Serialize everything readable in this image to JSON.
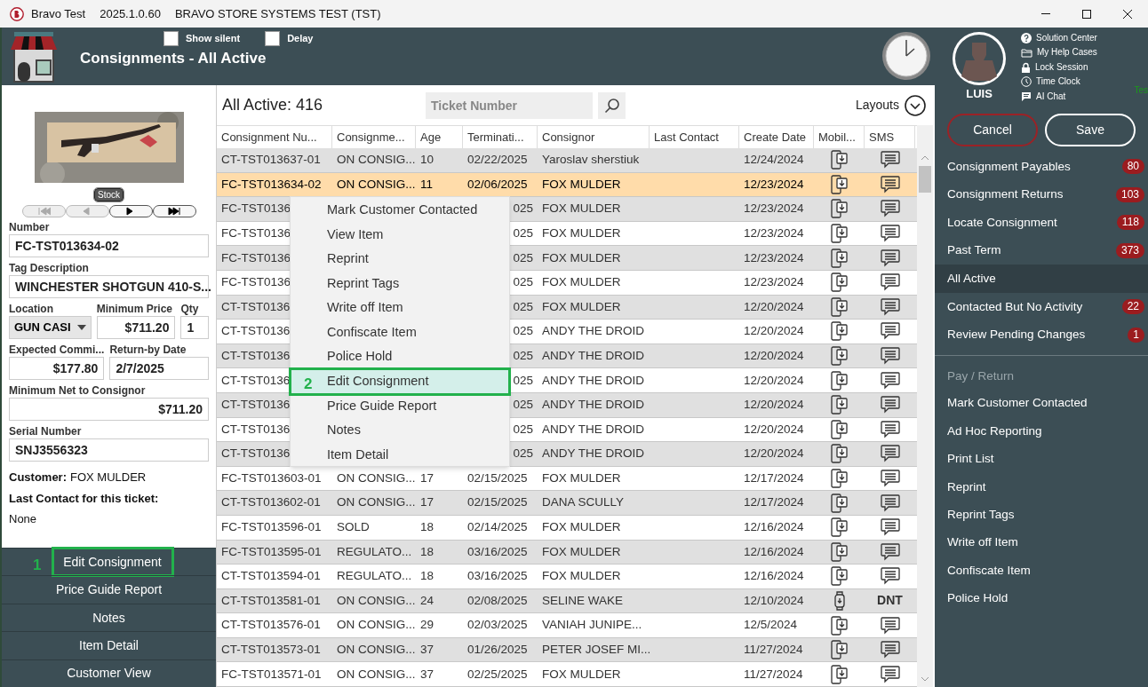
{
  "window": {
    "app": "Bravo Test",
    "version": "2025.1.0.60",
    "subtitle": "BRAVO STORE SYSTEMS TEST (TST)"
  },
  "header": {
    "title": "Consignments - All Active",
    "options": [
      {
        "label": "Show silent",
        "checked": false
      },
      {
        "label": "Delay",
        "checked": false
      }
    ]
  },
  "user": {
    "name": "LUIS",
    "links": [
      {
        "kind": "help",
        "label": "Solution Center"
      },
      {
        "kind": "folder",
        "label": "My Help Cases"
      },
      {
        "kind": "lock",
        "label": "Lock Session"
      },
      {
        "kind": "clock",
        "label": "Time Clock"
      },
      {
        "kind": "chat",
        "label": "AI Chat"
      }
    ],
    "env": "Tes"
  },
  "actions": {
    "cancel": "Cancel",
    "save": "Save"
  },
  "views": [
    {
      "label": "Consignment Payables",
      "count": "80",
      "selected": false
    },
    {
      "label": "Consignment Returns",
      "count": "103",
      "selected": false
    },
    {
      "label": "Locate Consignment",
      "count": "118",
      "selected": false
    },
    {
      "label": "Past Term",
      "count": "373",
      "selected": false
    },
    {
      "label": "All Active",
      "selected": true
    },
    {
      "label": "Contacted But No Activity",
      "count": "22",
      "selected": false
    },
    {
      "label": "Review Pending Changes",
      "count": "1",
      "selected": false
    }
  ],
  "pay_return": {
    "heading": "Pay / Return",
    "items": [
      "Mark Customer Contacted",
      "Ad Hoc Reporting",
      "Print List",
      "Reprint",
      "Reprint Tags",
      "Write off Item",
      "Confiscate Item",
      "Police Hold"
    ]
  },
  "detail": {
    "stock": "Stock",
    "nav": [
      {
        "kind": "first",
        "disabled": true
      },
      {
        "kind": "prev",
        "disabled": true
      },
      {
        "kind": "next",
        "disabled": false
      },
      {
        "kind": "last",
        "disabled": false
      }
    ],
    "number_label": "Number",
    "number": "FC-TST013634-02",
    "desc_label": "Tag Description",
    "desc": "WINCHESTER SHOTGUN 410-S...",
    "location_label": "Location",
    "location": "GUN CASI",
    "min_price_label": "Minimum Price",
    "min_price": "$711.20",
    "qty_label": "Qty",
    "qty": "1",
    "commission_label": "Expected Commi...",
    "commission": "$177.80",
    "return_label": "Return-by Date",
    "return_date": "2/7/2025",
    "net_label": "Minimum Net to Consignor",
    "net": "$711.20",
    "serial_label": "Serial Number",
    "serial": "SNJ3556323",
    "customer_label": "Customer:",
    "customer": "FOX MULDER",
    "last_contact_label": "Last Contact for this ticket:",
    "last_contact": "None",
    "buttons": [
      "Edit Consignment",
      "Price Guide Report",
      "Notes",
      "Item Detail",
      "Customer View"
    ]
  },
  "list": {
    "title": "All Active: 416",
    "search_placeholder": "Ticket Number",
    "layouts": "Layouts"
  },
  "table": {
    "columns": [
      "Consignment Nu...",
      "Consignme...",
      "Age",
      "Terminati...",
      "Consignor",
      "Last Contact",
      "Create Date",
      "Mobil...",
      "SMS"
    ],
    "rows": [
      {
        "kind": "full",
        "selected": false,
        "cells": [
          "CT-TST013637-01",
          "ON CONSIG...",
          "10",
          "02/22/2025",
          "Yaroslav sherstiuk",
          "",
          "12/24/2024"
        ],
        "watch": false
      },
      {
        "kind": "full",
        "selected": true,
        "cells": [
          "FC-TST013634-02",
          "ON CONSIG...",
          "11",
          "02/06/2025",
          "FOX MULDER",
          "",
          "12/23/2024"
        ],
        "watch": false
      },
      {
        "kind": "covered",
        "selected": false,
        "cells": [
          "FC-TST0136",
          "",
          "",
          "025",
          "FOX MULDER",
          "",
          "12/23/2024"
        ],
        "watch": false
      },
      {
        "kind": "covered",
        "selected": false,
        "cells": [
          "FC-TST0136",
          "",
          "",
          "025",
          "FOX MULDER",
          "",
          "12/23/2024"
        ],
        "watch": false
      },
      {
        "kind": "covered",
        "selected": false,
        "cells": [
          "FC-TST0136",
          "",
          "",
          "025",
          "FOX MULDER",
          "",
          "12/23/2024"
        ],
        "watch": false
      },
      {
        "kind": "covered",
        "selected": false,
        "cells": [
          "FC-TST0136",
          "",
          "",
          "025",
          "FOX MULDER",
          "",
          "12/23/2024"
        ],
        "watch": false
      },
      {
        "kind": "covered",
        "selected": false,
        "cells": [
          "CT-TST0136",
          "",
          "",
          "025",
          "FOX MULDER",
          "",
          "12/20/2024"
        ],
        "watch": false
      },
      {
        "kind": "covered",
        "selected": false,
        "cells": [
          "CT-TST0136",
          "",
          "",
          "025",
          "ANDY THE DROID",
          "",
          "12/20/2024"
        ],
        "watch": false
      },
      {
        "kind": "covered",
        "selected": false,
        "cells": [
          "CT-TST0136",
          "",
          "",
          "025",
          "ANDY THE DROID",
          "",
          "12/20/2024"
        ],
        "watch": false
      },
      {
        "kind": "covered",
        "selected": false,
        "cells": [
          "CT-TST0136",
          "",
          "",
          "025",
          "ANDY THE DROID",
          "",
          "12/20/2024"
        ],
        "watch": false
      },
      {
        "kind": "covered",
        "selected": false,
        "cells": [
          "CT-TST0136",
          "",
          "",
          "025",
          "ANDY THE DROID",
          "",
          "12/20/2024"
        ],
        "watch": false
      },
      {
        "kind": "covered",
        "selected": false,
        "cells": [
          "CT-TST0136",
          "",
          "",
          "025",
          "ANDY THE DROID",
          "",
          "12/20/2024"
        ],
        "watch": false
      },
      {
        "kind": "covered",
        "selected": false,
        "cells": [
          "CT-TST0136",
          "",
          "",
          "025",
          "ANDY THE DROID",
          "",
          "12/20/2024"
        ],
        "watch": false
      },
      {
        "kind": "full",
        "selected": false,
        "cells": [
          "FC-TST013603-01",
          "ON CONSIG...",
          "17",
          "02/15/2025",
          "FOX MULDER",
          "",
          "12/17/2024"
        ],
        "watch": false
      },
      {
        "kind": "full",
        "selected": false,
        "cells": [
          "CT-TST013602-01",
          "ON CONSIG...",
          "17",
          "02/15/2025",
          "DANA SCULLY",
          "",
          "12/17/2024"
        ],
        "watch": false
      },
      {
        "kind": "full",
        "selected": false,
        "cells": [
          "FC-TST013596-01",
          "SOLD",
          "18",
          "02/14/2025",
          "FOX MULDER",
          "",
          "12/16/2024"
        ],
        "watch": false
      },
      {
        "kind": "full",
        "selected": false,
        "cells": [
          "FC-TST013595-01",
          "REGULATO...",
          "18",
          "03/16/2025",
          "FOX MULDER",
          "",
          "12/16/2024"
        ],
        "watch": false
      },
      {
        "kind": "full",
        "selected": false,
        "cells": [
          "CT-TST013594-01",
          "REGULATO...",
          "18",
          "03/16/2025",
          "FOX MULDER",
          "",
          "12/16/2024"
        ],
        "watch": false
      },
      {
        "kind": "full",
        "selected": false,
        "cells": [
          "CT-TST013581-01",
          "ON CONSIG...",
          "24",
          "02/08/2025",
          "SELINE WAKE",
          "",
          "12/10/2024"
        ],
        "watch": true,
        "sms_text": "DNT"
      },
      {
        "kind": "full",
        "selected": false,
        "cells": [
          "CT-TST013576-01",
          "ON CONSIG...",
          "29",
          "02/03/2025",
          "VANIAH JUNIPE...",
          "",
          "12/5/2024"
        ],
        "watch": false
      },
      {
        "kind": "full",
        "selected": false,
        "cells": [
          "CT-TST013573-01",
          "ON CONSIG...",
          "37",
          "01/26/2025",
          "PETER JOSEF MI...",
          "",
          "11/27/2024"
        ],
        "watch": false
      },
      {
        "kind": "full",
        "selected": false,
        "cells": [
          "FC-TST013571-01",
          "ON CONSIG...",
          "37",
          "02/25/2025",
          "FOX MULDER",
          "",
          "11/27/2024"
        ],
        "watch": false
      }
    ]
  },
  "context_menu": [
    {
      "label": "Mark Customer Contacted",
      "selected": false
    },
    {
      "label": "View Item",
      "selected": false
    },
    {
      "label": "Reprint",
      "selected": false
    },
    {
      "label": "Reprint Tags",
      "selected": false
    },
    {
      "label": "Write off Item",
      "selected": false
    },
    {
      "label": "Confiscate Item",
      "selected": false
    },
    {
      "label": "Police Hold",
      "selected": false
    },
    {
      "label": "Edit Consignment",
      "selected": true
    },
    {
      "label": "Price Guide Report",
      "selected": false
    },
    {
      "label": "Notes",
      "selected": false
    },
    {
      "label": "Item Detail",
      "selected": false
    }
  ],
  "callouts": [
    "1",
    "2"
  ]
}
